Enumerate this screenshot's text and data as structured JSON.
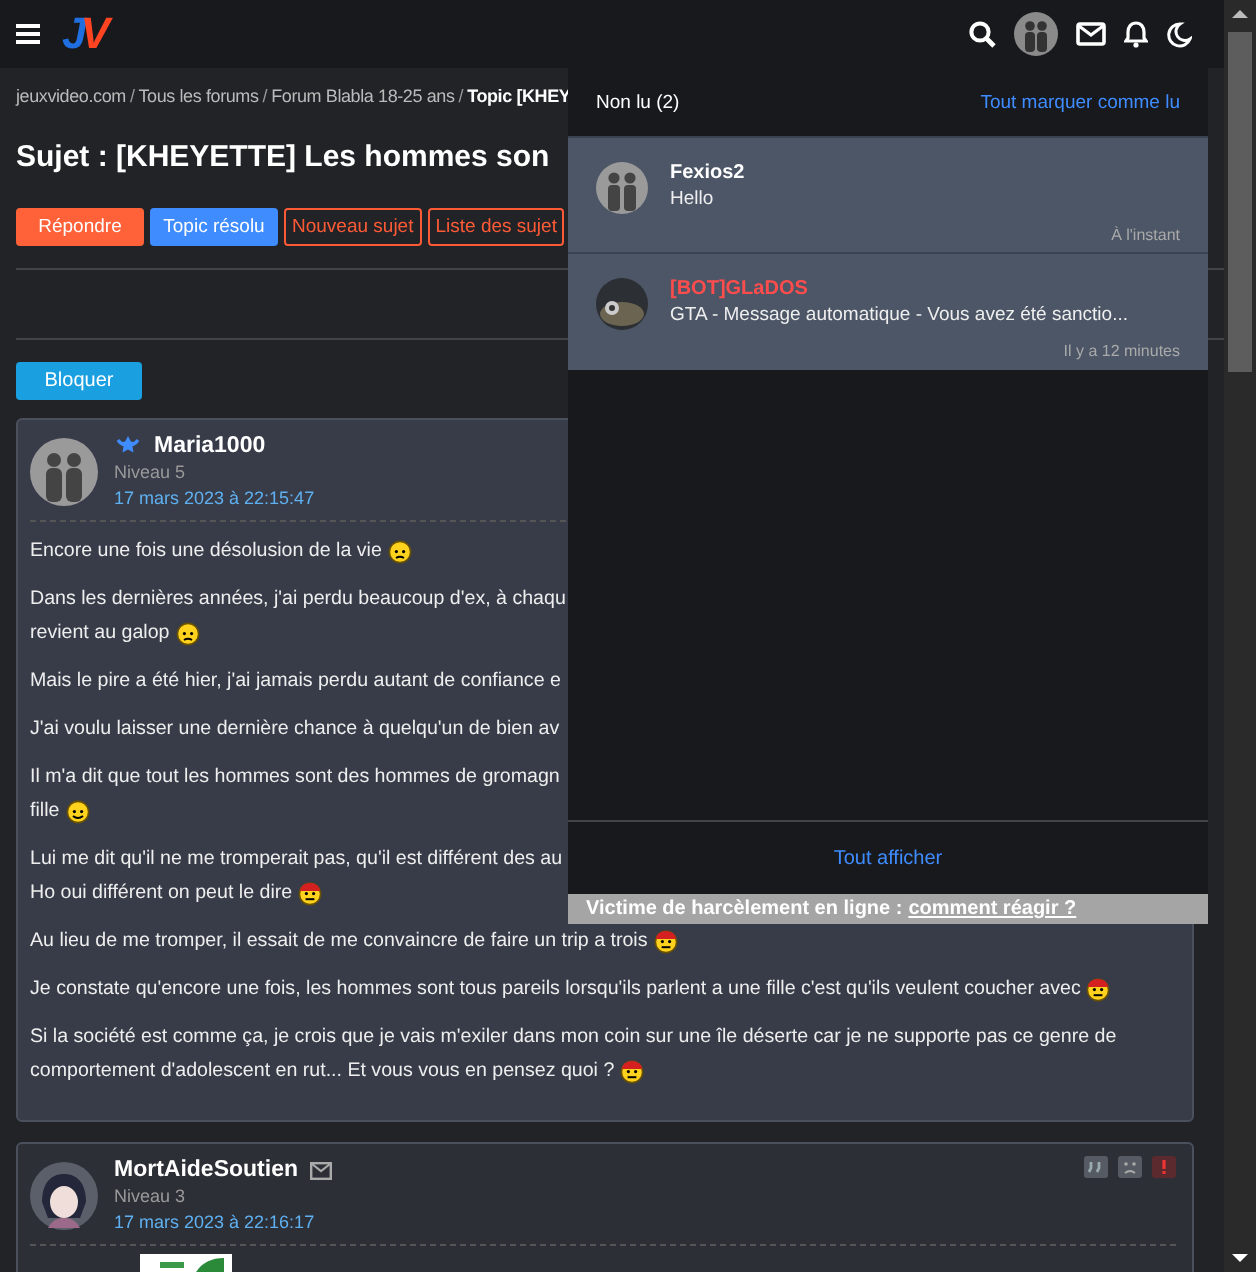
{
  "topbar": {
    "logo": "JV"
  },
  "breadcrumb": [
    {
      "label": "jeuxvideo.com",
      "current": false
    },
    {
      "label": "Tous les forums",
      "current": false
    },
    {
      "label": "Forum Blabla 18-25 ans",
      "current": false
    },
    {
      "label": "Topic [KHEY",
      "current": true
    }
  ],
  "breadcrumb_separator": "/",
  "title": "Sujet : [KHEYETTE] Les hommes son",
  "actions": [
    {
      "label": "Répondre",
      "kind": "solid",
      "color": "#ff6138"
    },
    {
      "label": "Topic résolu",
      "kind": "solid",
      "color": "#3f8cff"
    },
    {
      "label": "Nouveau sujet",
      "kind": "outline",
      "color": "#ff5a36"
    },
    {
      "label": "Liste des sujet",
      "kind": "outline",
      "color": "#ff5a36"
    }
  ],
  "block_button": "Bloquer",
  "posts": [
    {
      "author": "Maria1000",
      "badge": true,
      "mail": false,
      "level": "Niveau 5",
      "date": "17 mars 2023 à 22:15:47",
      "avatar": {
        "kind": "figures"
      },
      "paragraphs": [
        {
          "lines": [
            "Encore une fois une désolusion de la vie"
          ],
          "smiley": {
            "kind": "worried"
          }
        },
        {
          "lines": [
            "Dans les dernières années, j'ai perdu beaucoup d'ex, à chaqu",
            "revient au galop"
          ],
          "smiley": {
            "kind": "worried"
          }
        },
        {
          "lines": [
            "Mais le pire a été hier, j'ai jamais perdu autant de confiance e"
          ]
        },
        {
          "lines": [
            "J'ai voulu laisser une dernière chance à quelqu'un de bien av"
          ]
        },
        {
          "lines": [
            "Il m'a dit que tout les hommes sont des hommes de gromagn",
            "fille"
          ],
          "smiley": {
            "kind": "grin"
          }
        },
        {
          "lines": [
            "Lui me dit qu'il ne me tromperait pas, qu'il est différent des au",
            "Ho oui différent on peut le dire"
          ],
          "smiley": {
            "kind": "cap"
          }
        },
        {
          "lines": [
            "Au lieu de me tromper, il essait de me convaincre de faire un trip a trois"
          ],
          "smiley": {
            "kind": "cap"
          }
        },
        {
          "lines": [
            "Je constate qu'encore une fois, les hommes sont tous pareils lorsqu'ils parlent a une fille c'est qu'ils veulent coucher avec"
          ],
          "smiley": {
            "kind": "cap"
          }
        },
        {
          "lines": [
            "Si la société est comme ça, je crois que je vais m'exiler dans mon coin sur une île déserte car je ne supporte pas ce genre de",
            "comportement d'adolescent en rut... Et vous vous en pensez quoi ?"
          ],
          "smiley": {
            "kind": "cap"
          }
        }
      ],
      "tools": false,
      "image": false
    },
    {
      "author": "MortAideSoutien",
      "badge": false,
      "mail": true,
      "level": "Niveau 3",
      "date": "17 mars 2023 à 22:16:17",
      "avatar": {
        "kind": "character"
      },
      "tools": true,
      "image": true
    }
  ],
  "notifications": {
    "tab": "Non lu (2)",
    "mark_all": "Tout marquer comme lu",
    "items": [
      {
        "name": "Fexios2",
        "color": "#ffffff",
        "message": "Hello",
        "time": "À l'instant",
        "avatar": {
          "kind": "figures"
        }
      },
      {
        "name": "[BOT]GLaDOS",
        "color": "#ff4c4c",
        "message": "GTA - Message automatique - Vous avez été sanctio...",
        "time": "Il y a 12 minutes",
        "avatar": {
          "kind": "robot"
        }
      }
    ],
    "show_all": "Tout afficher"
  },
  "harassment_bar": {
    "text": "Victime de harcèlement en ligne :",
    "link": "comment réagir ?"
  }
}
